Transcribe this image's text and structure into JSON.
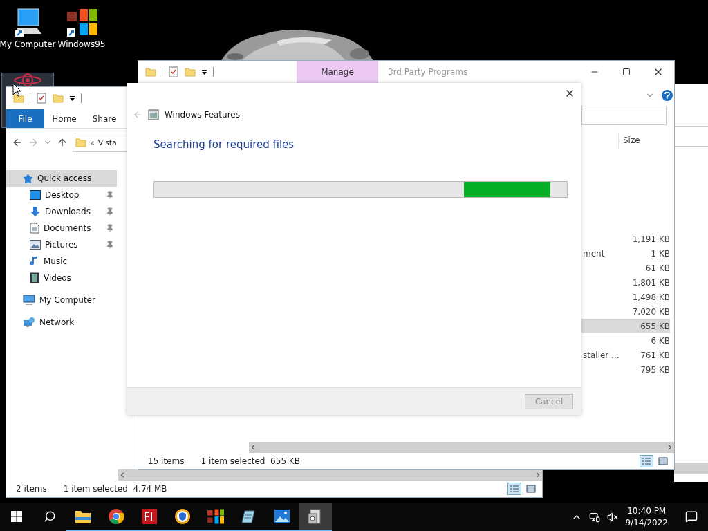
{
  "desktop": {
    "icons": [
      {
        "kind": "computer",
        "label": "My Computer",
        "selected": false
      },
      {
        "kind": "win95",
        "label": "Windows95",
        "selected": false
      },
      {
        "kind": "atom",
        "selected": true
      }
    ]
  },
  "explorer_left": {
    "tabs": [
      {
        "label": "File",
        "selected": true
      },
      {
        "label": "Home",
        "selected": false
      },
      {
        "label": "Share",
        "selected": false
      }
    ],
    "address": {
      "chevron": "«",
      "path": "Vista"
    },
    "nav": [
      {
        "kind": "quick",
        "label": "Quick access",
        "selected": true,
        "children": [
          {
            "kind": "desktop",
            "label": "Desktop",
            "pinned": true,
            "selected": false
          },
          {
            "kind": "downloads",
            "label": "Downloads",
            "pinned": true,
            "selected": false
          },
          {
            "kind": "documents",
            "label": "Documents",
            "pinned": true,
            "selected": false
          },
          {
            "kind": "pictures",
            "label": "Pictures",
            "pinned": true,
            "selected": false
          },
          {
            "kind": "music",
            "label": "Music",
            "pinned": false,
            "selected": false
          },
          {
            "kind": "videos",
            "label": "Videos",
            "pinned": false,
            "selected": false
          }
        ]
      },
      {
        "kind": "computer",
        "label": "My Computer",
        "selected": false
      },
      {
        "kind": "network",
        "label": "Network",
        "selected": false
      }
    ],
    "status": {
      "count": "2 items",
      "selection": "1 item selected  4.74 MB"
    },
    "view": {
      "details_selected": true
    }
  },
  "explorer_right": {
    "context_tab": "Manage",
    "title": "3rd Party Programs",
    "columns": [
      {
        "label": "Size"
      }
    ],
    "rows": [
      {
        "name": "",
        "size": "1,191 KB",
        "selected": false
      },
      {
        "name": "ment",
        "size": "1 KB",
        "selected": false
      },
      {
        "name": "",
        "size": "61 KB",
        "selected": false
      },
      {
        "name": "",
        "size": "1,801 KB",
        "selected": false
      },
      {
        "name": "",
        "size": "1,498 KB",
        "selected": false
      },
      {
        "name": "",
        "size": "7,020 KB",
        "selected": false
      },
      {
        "name": "",
        "size": "655 KB",
        "selected": true
      },
      {
        "name": "",
        "size": "6 KB",
        "selected": false
      },
      {
        "name": "staller ...",
        "size": "761 KB",
        "selected": false
      },
      {
        "name": "",
        "size": "795 KB",
        "selected": false
      }
    ],
    "status": {
      "count": "15 items",
      "selection": "1 item selected  655 KB"
    },
    "view": {
      "details_selected": true
    }
  },
  "dialog": {
    "title": "Windows Features",
    "heading": "Searching for required files",
    "progress": {
      "kind": "marquee",
      "level": 0.96
    },
    "cancel": {
      "label": "Cancel",
      "disabled": true
    }
  },
  "taskbar": {
    "apps": [
      {
        "kind": "explorer",
        "running": true,
        "active": false
      },
      {
        "kind": "chrome",
        "running": true,
        "active": false
      },
      {
        "kind": "flash",
        "running": true,
        "active": false
      },
      {
        "kind": "shield",
        "running": true,
        "active": false
      },
      {
        "kind": "win95",
        "running": true,
        "active": false
      },
      {
        "kind": "notepad",
        "running": true,
        "active": false
      },
      {
        "kind": "photos",
        "running": true,
        "active": false
      },
      {
        "kind": "features",
        "running": true,
        "active": true
      }
    ],
    "time": "10:40 PM",
    "date": "9/14/2022"
  }
}
